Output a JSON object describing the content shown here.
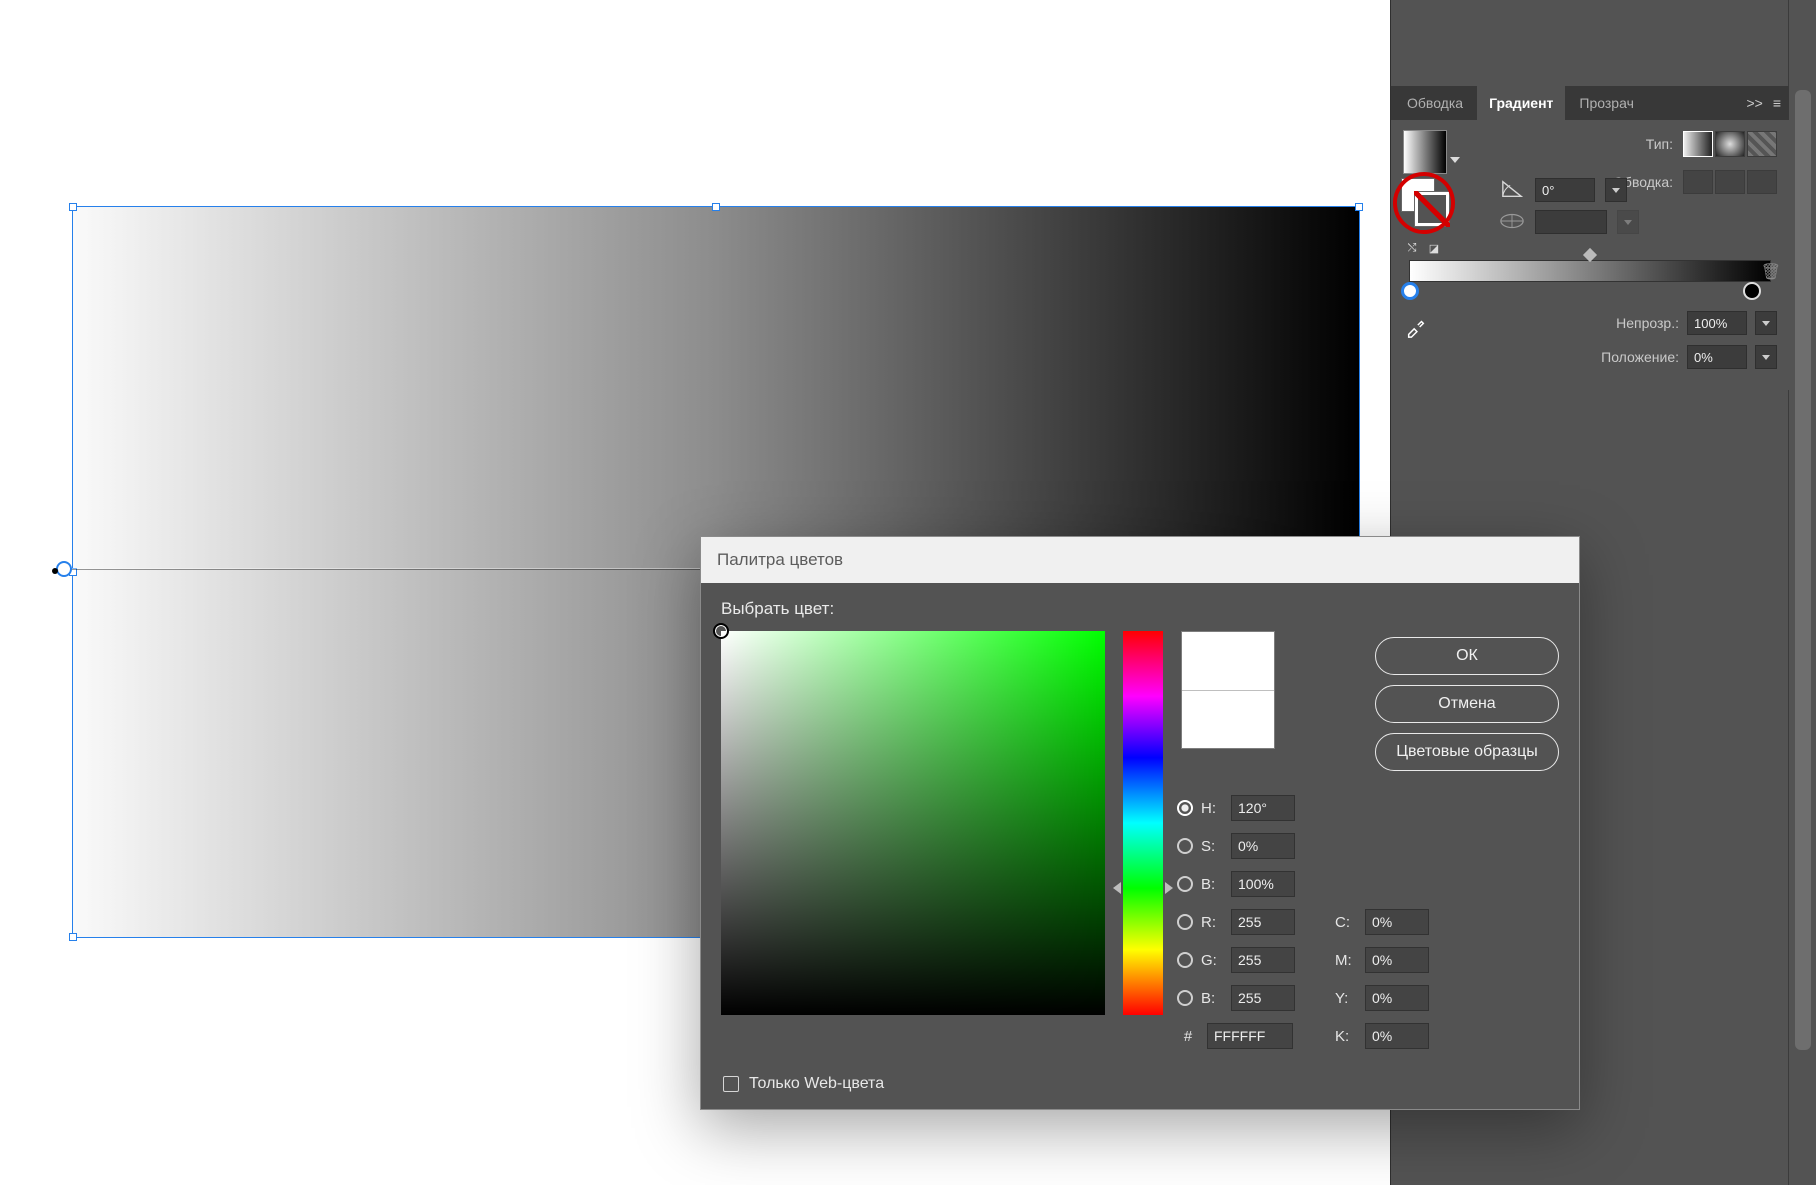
{
  "canvas": {
    "gradient_from": "#ffffff",
    "gradient_to": "#000000"
  },
  "panel": {
    "tabs": {
      "stroke": "Обводка",
      "gradient": "Градиент",
      "transparency": "Прозрач",
      "more": ">>"
    },
    "type_label": "Тип:",
    "stroke_label": "Обводка:",
    "angle_value": "0°",
    "aspect_value": "",
    "opacity_label": "Непрозр.:",
    "opacity_value": "100%",
    "position_label": "Положение:",
    "position_value": "0%"
  },
  "picker": {
    "title": "Палитра цветов",
    "heading": "Выбрать цвет:",
    "buttons": {
      "ok": "ОК",
      "cancel": "Отмена",
      "swatches": "Цветовые образцы"
    },
    "hsb": {
      "h_label": "H:",
      "h_value": "120°",
      "s_label": "S:",
      "s_value": "0%",
      "b_label": "B:",
      "b_value": "100%"
    },
    "rgb": {
      "r_label": "R:",
      "r_value": "255",
      "g_label": "G:",
      "g_value": "255",
      "b_label": "B:",
      "b_value": "255"
    },
    "hex_label": "#",
    "hex_value": "FFFFFF",
    "cmyk": {
      "c_label": "C:",
      "c_value": "0%",
      "m_label": "M:",
      "m_value": "0%",
      "y_label": "Y:",
      "y_value": "0%",
      "k_label": "K:",
      "k_value": "0%"
    },
    "web_only_label": "Только Web-цвета"
  }
}
